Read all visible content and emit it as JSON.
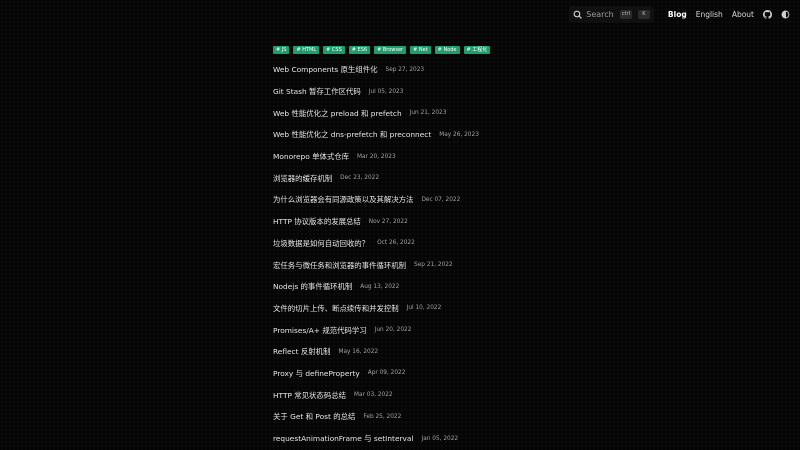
{
  "nav": {
    "search_label": "Search",
    "search_shortcut_keys": [
      "ctrl",
      "K"
    ],
    "links": [
      {
        "label": "Blog",
        "active": true
      },
      {
        "label": "English",
        "active": false
      },
      {
        "label": "About",
        "active": false
      }
    ],
    "icons": [
      "github-icon",
      "theme-toggle-icon"
    ]
  },
  "tags": [
    "# JS",
    "# HTML",
    "# CSS",
    "# ES6",
    "# Browser",
    "# Net",
    "# Node",
    "# 工程化"
  ],
  "posts": [
    {
      "title": "Web Components 原生组件化",
      "date": "Sep 27, 2023"
    },
    {
      "title": "Git Stash 暂存工作区代码",
      "date": "Jul 05, 2023"
    },
    {
      "title": "Web 性能优化之 preload 和 prefetch",
      "date": "Jun 21, 2023"
    },
    {
      "title": "Web 性能优化之 dns-prefetch 和 preconnect",
      "date": "May 26, 2023"
    },
    {
      "title": "Monorepo 单体式仓库",
      "date": "Mar 20, 2023"
    },
    {
      "title": "浏览器的缓存机制",
      "date": "Dec 23, 2022"
    },
    {
      "title": "为什么浏览器会有同源政策以及其解决方法",
      "date": "Dec 07, 2022"
    },
    {
      "title": "HTTP 协议版本的发展总结",
      "date": "Nov 27, 2022"
    },
    {
      "title": "垃圾数据是如何自动回收的？",
      "date": "Oct 26, 2022"
    },
    {
      "title": "宏任务与微任务和浏览器的事件循环机制",
      "date": "Sep 21, 2022"
    },
    {
      "title": "Nodejs 的事件循环机制",
      "date": "Aug 13, 2022"
    },
    {
      "title": "文件的切片上传、断点续传和并发控制",
      "date": "Jul 10, 2022"
    },
    {
      "title": "Promises/A+ 规范代码学习",
      "date": "Jun 20, 2022"
    },
    {
      "title": "Reflect 反射机制",
      "date": "May 16, 2022"
    },
    {
      "title": "Proxy 与 defineProperty",
      "date": "Apr 09, 2022"
    },
    {
      "title": "HTTP 常见状态码总结",
      "date": "Mar 03, 2022"
    },
    {
      "title": "关于 Get 和 Post 的总结",
      "date": "Feb 25, 2022"
    },
    {
      "title": "requestAnimationFrame 与 setInterval",
      "date": "Jan 05, 2022"
    }
  ],
  "colors": {
    "background": "#050505",
    "tag_bg": "#1f9e6c",
    "text": "#e8e8e8",
    "muted": "#a3a3a3"
  }
}
